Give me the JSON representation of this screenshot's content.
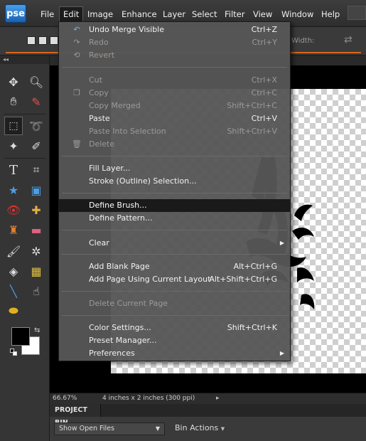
{
  "app": {
    "logo": "pse"
  },
  "menubar": {
    "items": [
      "File",
      "Edit",
      "Image",
      "Enhance",
      "Layer",
      "Select",
      "Filter",
      "View",
      "Window",
      "Help"
    ],
    "active": "Edit"
  },
  "options_bar": {
    "width_label": "Width:"
  },
  "edit_menu": {
    "items": [
      {
        "label": "Undo Merge Visible",
        "shortcut": "Ctrl+Z",
        "enabled": true,
        "icon": "undo-icon"
      },
      {
        "label": "Redo",
        "shortcut": "Ctrl+Y",
        "enabled": false,
        "icon": "redo-icon"
      },
      {
        "label": "Revert",
        "shortcut": "",
        "enabled": false,
        "icon": "revert-icon"
      },
      {
        "label": "Cut",
        "shortcut": "Ctrl+X",
        "enabled": false,
        "icon": "cut-icon"
      },
      {
        "label": "Copy",
        "shortcut": "Ctrl+C",
        "enabled": false,
        "icon": "copy-icon"
      },
      {
        "label": "Copy Merged",
        "shortcut": "Shift+Ctrl+C",
        "enabled": false,
        "icon": ""
      },
      {
        "label": "Paste",
        "shortcut": "Ctrl+V",
        "enabled": true,
        "icon": ""
      },
      {
        "label": "Paste Into Selection",
        "shortcut": "Shift+Ctrl+V",
        "enabled": false,
        "icon": ""
      },
      {
        "label": "Delete",
        "shortcut": "",
        "enabled": false,
        "icon": "trash-icon"
      },
      {
        "label": "Fill Layer...",
        "shortcut": "",
        "enabled": true,
        "icon": ""
      },
      {
        "label": "Stroke (Outline) Selection...",
        "shortcut": "",
        "enabled": true,
        "icon": ""
      },
      {
        "label": "Define Brush...",
        "shortcut": "",
        "enabled": true,
        "icon": "",
        "highlighted": true
      },
      {
        "label": "Define Pattern...",
        "shortcut": "",
        "enabled": true,
        "icon": ""
      },
      {
        "label": "Clear",
        "shortcut": "",
        "enabled": true,
        "icon": "",
        "submenu": true
      },
      {
        "label": "Add Blank Page",
        "shortcut": "Alt+Ctrl+G",
        "enabled": true,
        "icon": ""
      },
      {
        "label": "Add Page Using Current Layout",
        "shortcut": "Alt+Shift+Ctrl+G",
        "enabled": true,
        "icon": ""
      },
      {
        "label": "Delete Current Page",
        "shortcut": "",
        "enabled": false,
        "icon": ""
      },
      {
        "label": "Color Settings...",
        "shortcut": "Shift+Ctrl+K",
        "enabled": true,
        "icon": ""
      },
      {
        "label": "Preset Manager...",
        "shortcut": "",
        "enabled": true,
        "icon": ""
      },
      {
        "label": "Preferences",
        "shortcut": "",
        "enabled": true,
        "icon": "",
        "submenu": true
      }
    ]
  },
  "status": {
    "zoom": "66.67%",
    "doc_size": "4 inches x 2 inches (300 ppi)"
  },
  "project_bin": {
    "tab": "PROJECT BIN",
    "show_select": "Show Open Files",
    "actions": "Bin Actions"
  },
  "colors": {
    "accent": "#d9651b",
    "foreground": "#000000",
    "background": "#ffffff"
  }
}
